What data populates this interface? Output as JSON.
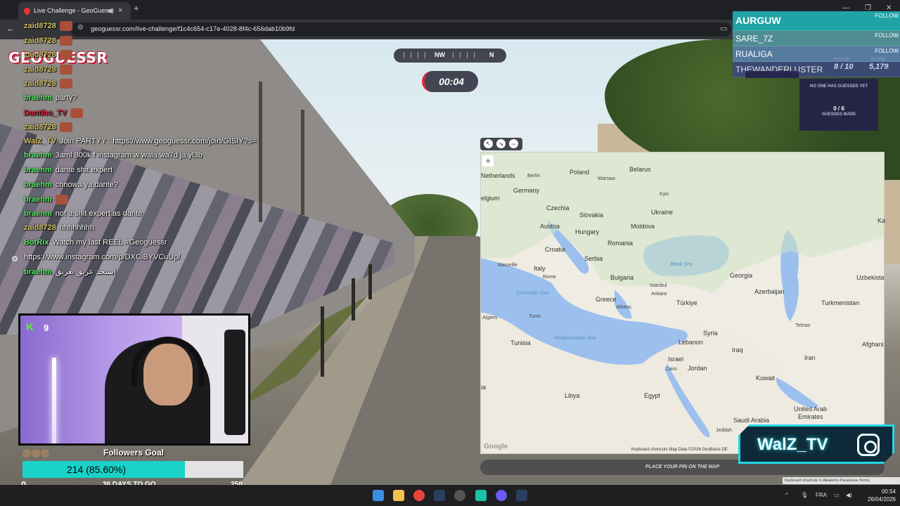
{
  "browser": {
    "tab_title": "Live Challenge - GeoGuessr",
    "url": "geoguessr.com/live-challenge/f1c4c654-c17e-4028-8f4c-656dab10b9fd"
  },
  "game": {
    "logo": "GEOGUESSR",
    "compass_dir": "NW",
    "compass_dir2": "N",
    "timer": "00:04",
    "round_label": "ROUND",
    "score_label": "SCORE",
    "round": "8 / 10",
    "score": "5,179",
    "no_guess": "NO ONE HAS GUESSED YET",
    "guess_count": "0 / 6",
    "guesses_made": "GUESSES MADE",
    "place_pin": "PLACE YOUR PIN ON THE MAP"
  },
  "leaderboard": {
    "follow_label": "FOLLOW",
    "players": [
      "AURGUW",
      "SARE_7Z",
      "RUALIGA",
      "THEWANDERLUSTER"
    ]
  },
  "map": {
    "zoom_in": "+",
    "attribution": "Keyboard shortcuts   Map Data ©2026 GeoBasis-DE",
    "google": "Google",
    "labels": {
      "netherlands": "Netherlands",
      "berlin": "Berlin",
      "poland": "Poland",
      "warsaw": "Warsaw",
      "belarus": "Belarus",
      "germany": "Germany",
      "belgium": "elgium",
      "czechia": "Czechia",
      "kyiv": "Kyiv",
      "ukraine": "Ukraine",
      "slovakia": "Slovakia",
      "austria": "Austria",
      "hungary": "Hungary",
      "moldova": "Moldova",
      "croatia": "Croatia",
      "romania": "Romania",
      "marseille": "Marseille",
      "italy": "Italy",
      "serbia": "Serbia",
      "blacksea": "Black Sea",
      "bulgaria": "Bulgaria",
      "georgia": "Georgia",
      "istanbul": "Istanbul",
      "rome": "Rome",
      "azerbaijan": "Azerbaijan",
      "uzbekistan": "Uzbekista",
      "tyrrhenian": "Tyrrhenian Sea",
      "greece": "Greece",
      "ankara": "Ankara",
      "turkiye": "Türkiye",
      "turkmenistan": "Turkmenistan",
      "athens": "Athens",
      "algiers": "Algiers",
      "tunis": "Tunis",
      "syria": "Syria",
      "tehran": "Tehran",
      "tunisia": "Tunisia",
      "med": "Mediterranean Sea",
      "lebanon": "Lebanon",
      "afghan": "Afghani",
      "iraq": "Iraq",
      "israel": "Israel",
      "cairo": "Cairo",
      "jordan": "Jordan",
      "iran": "Iran",
      "kuwait": "Kuwait",
      "libya": "Libya",
      "egypt": "Egypt",
      "ia": "ia",
      "uae": "United Arab",
      "emirates": "Emirates",
      "saudi": "Saudi Arabia",
      "jeddah": "Jeddah",
      "ka": "Ka"
    }
  },
  "chat": [
    {
      "user": "zaid8728",
      "text": "",
      "emote": true,
      "color": "#d4c46a"
    },
    {
      "user": "zaid8728",
      "text": "",
      "emote": true,
      "color": "#d4c46a"
    },
    {
      "user": "zaid8728",
      "text": "",
      "emote": true,
      "color": "#d4c46a"
    },
    {
      "user": "zaid8728",
      "text": "",
      "emote": true,
      "color": "#d4c46a"
    },
    {
      "user": "zaid8728",
      "text": "",
      "emote": true,
      "color": "#d4c46a"
    },
    {
      "user": "braehm",
      "text": "party?",
      "emote": false,
      "color": "#5ee86a"
    },
    {
      "user": "Dantiho_TV",
      "text": "",
      "emote": true,
      "color": "#d8243a"
    },
    {
      "user": "zaid8728",
      "text": "",
      "emote": true,
      "color": "#d4c46a"
    },
    {
      "user": "WalZ_TV",
      "text": "Join PARTYY : https://www.geoguessr.com/join/GISIY?s=",
      "emote": false,
      "color": "#d4c46a"
    },
    {
      "user": "braehm",
      "text": "3aml 800k f instagram w wala wa7d ja yl3b",
      "emote": false,
      "color": "#5ee86a"
    },
    {
      "user": "braehm",
      "text": "dante shit expert",
      "emote": false,
      "color": "#5ee86a"
    },
    {
      "user": "braehm",
      "text": "chnowa ya dante?",
      "emote": false,
      "color": "#5ee86a"
    },
    {
      "user": "braehm",
      "text": "",
      "emote": true,
      "color": "#5ee86a"
    },
    {
      "user": "braehm",
      "text": "not a shit expert as dante",
      "emote": false,
      "color": "#5ee86a"
    },
    {
      "user": "zaid8728",
      "text": "hhhhhhhh",
      "emote": false,
      "color": "#d4c46a"
    },
    {
      "user": "BotRix",
      "text": "Watch my last REEL #Geoguessr",
      "emote": false,
      "color": "#5ee86a"
    },
    {
      "user": "",
      "text": "https://www.instagram.com/p/DXCiBYVCuUp/",
      "emote": false,
      "color": "#ffffff"
    },
    {
      "user": "braehm",
      "text": "استحد عريق بعريق",
      "emote": false,
      "color": "#5ee86a"
    }
  ],
  "cam": {
    "badge": "K",
    "count": "9"
  },
  "goal": {
    "title": "Followers Goal",
    "value": "214 (85.60%)",
    "progress": 0.856,
    "min": "0",
    "days": "36 DAYS TO GO",
    "max": "250"
  },
  "brand": {
    "name": "WalZ_TV"
  },
  "streetview": {
    "footer": "Keyboard shortcuts  © Aikaterini Paraskeva   Terms"
  },
  "taskbar": {
    "lang": "FRA",
    "time": "00:54",
    "date": "26/04/2026"
  },
  "colors": {
    "accent": "#21d7e7",
    "timer": "#e5283a",
    "leader": "#1fa3a5"
  }
}
